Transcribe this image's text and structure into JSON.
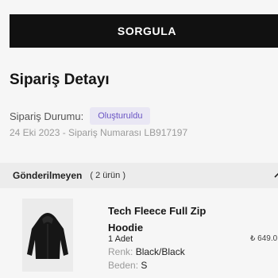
{
  "query_button_label": "SORGULA",
  "page_title": "Sipariş Detayı",
  "order": {
    "status_label": "Sipariş Durumu:",
    "status_value": "Oluşturuldu",
    "meta": "24 Eki 2023 - Sipariş Numarası LB917197"
  },
  "shipment": {
    "title": "Gönderilmeyen",
    "count": "( 2 ürün )"
  },
  "product": {
    "name": "Tech Fleece Full Zip Hoodie",
    "quantity": "1 Adet",
    "color_label": "Renk:",
    "color_value": "Black/Black",
    "size_label": "Beden:",
    "size_value": "S",
    "price": "₺ 649.0"
  },
  "colors": {
    "button_bg": "#111111",
    "status_badge_bg": "#e9e7f4",
    "status_badge_text": "#6a55c4",
    "shipment_header_bg": "#ececec"
  },
  "icons": [
    "chevron-up-icon",
    "hoodie-icon"
  ]
}
